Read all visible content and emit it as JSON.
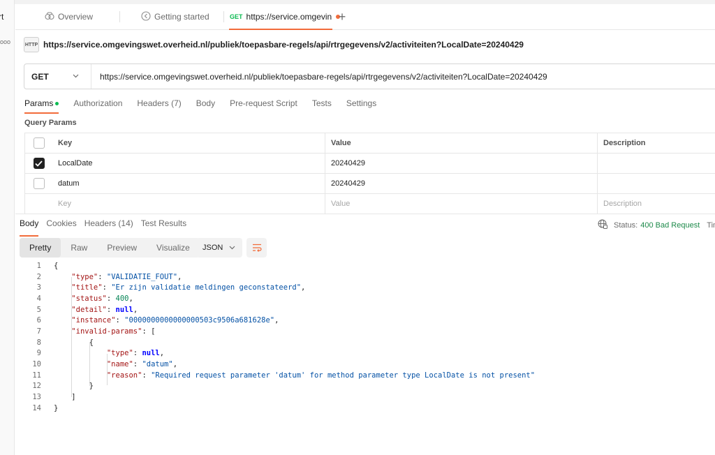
{
  "left_strip": {
    "clip_text": "rt",
    "dots": "ooo"
  },
  "tabs": {
    "overview": "Overview",
    "getting_started": "Getting started",
    "active_method": "GET",
    "active_label": "https://service.omgevin",
    "plus": "+"
  },
  "request": {
    "title": "https://service.omgevingswet.overheid.nl/publiek/toepasbare-regels/api/rtrgegevens/v2/activiteiten?LocalDate=20240429",
    "http_icon": "HTTP",
    "method": "GET",
    "url": "https://service.omgevingswet.overheid.nl/publiek/toepasbare-regels/api/rtrgegevens/v2/activiteiten?LocalDate=20240429"
  },
  "request_tabs": [
    "Params",
    "Authorization",
    "Headers (7)",
    "Body",
    "Pre-request Script",
    "Tests",
    "Settings"
  ],
  "query_params": {
    "label": "Query Params",
    "headers": {
      "key": "Key",
      "value": "Value",
      "description": "Description"
    },
    "rows": [
      {
        "checked": true,
        "key": "LocalDate",
        "value": "20240429",
        "description": ""
      },
      {
        "checked": false,
        "key": "datum",
        "value": "20240429",
        "description": ""
      }
    ],
    "placeholder": {
      "key": "Key",
      "value": "Value",
      "description": "Description"
    }
  },
  "response_tabs": [
    "Body",
    "Cookies",
    "Headers (14)",
    "Test Results"
  ],
  "status": {
    "label": "Status:",
    "value": "400 Bad Request",
    "time_label": "Time"
  },
  "view_modes": [
    "Pretty",
    "Raw",
    "Preview",
    "Visualize"
  ],
  "format": "JSON",
  "code_lines": [
    {
      "num": "1"
    },
    {
      "num": "2",
      "key": "\"type\"",
      "str": "\"VALIDATIE_FOUT\""
    },
    {
      "num": "3",
      "key": "\"title\"",
      "str": "\"Er zijn validatie meldingen geconstateerd\""
    },
    {
      "num": "4",
      "key": "\"status\"",
      "numval": "400"
    },
    {
      "num": "5",
      "key": "\"detail\"",
      "nullval": "null"
    },
    {
      "num": "6",
      "key": "\"instance\"",
      "str": "\"0000000000000000503c9506a681628e\""
    },
    {
      "num": "7",
      "key": "\"invalid-params\""
    },
    {
      "num": "8"
    },
    {
      "num": "9",
      "key": "\"type\"",
      "nullval": "null"
    },
    {
      "num": "10",
      "key": "\"name\"",
      "str": "\"datum\""
    },
    {
      "num": "11",
      "key": "\"reason\"",
      "str": "\"Required request parameter 'datum' for method parameter type LocalDate is not present\""
    },
    {
      "num": "12"
    },
    {
      "num": "13"
    },
    {
      "num": "14"
    }
  ]
}
